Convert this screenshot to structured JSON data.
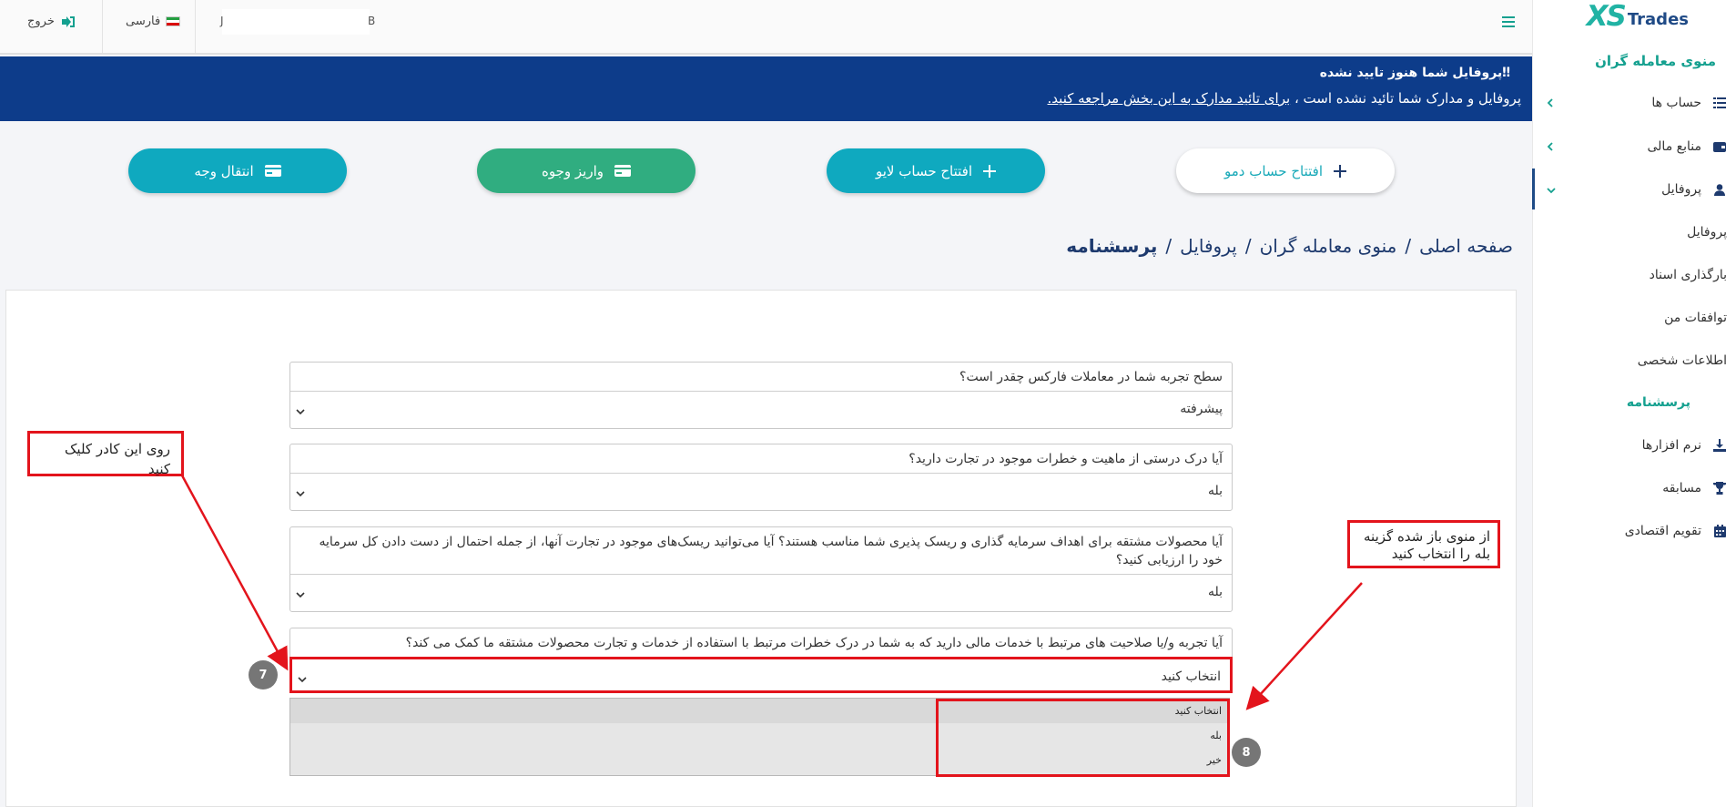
{
  "brand": {
    "logo_xs": "XS",
    "logo_trades": "Trades"
  },
  "header": {
    "language_label": "فارسی",
    "logout_label": "خروج",
    "user_fragment_left": "J",
    "user_fragment_right": "B"
  },
  "sidebar": {
    "title": "منوی معامله گران",
    "items": [
      {
        "label": "حساب ها",
        "icon": "list-icon"
      },
      {
        "label": "منابع مالی",
        "icon": "wallet-icon"
      },
      {
        "label": "پروفایل",
        "icon": "user-icon"
      }
    ],
    "profile_sub": [
      "پروفایل",
      "بارگذاری اسناد",
      "توافقات من",
      "اطلاعات شخصی",
      "پرسشنامه"
    ],
    "bottom_items": [
      {
        "label": "نرم افزارها",
        "icon": "download-icon"
      },
      {
        "label": "مسابقه",
        "icon": "trophy-icon"
      },
      {
        "label": "تقویم اقتصادی",
        "icon": "calendar-icon"
      }
    ]
  },
  "alert": {
    "title": "پروفایل شما هنوز تایید نشده",
    "text_prefix": "پروفایل و مدارک شما تائید نشده است ،",
    "link_text": "برای تائید مدارک به این بخش مراجعه کنید."
  },
  "actions": {
    "demo": "افتتاح حساب دمو",
    "live": "افتتاح حساب لایو",
    "deposit": "واریز وجوه",
    "transfer": "انتقال وجه"
  },
  "breadcrumb": [
    "صفحه اصلی",
    "منوی معامله گران",
    "پروفایل",
    "پرسشنامه"
  ],
  "questionnaire": [
    {
      "question": "سطح تجربه شما در معاملات فارکس چقدر است؟",
      "value": "پیشرفته"
    },
    {
      "question": "آیا درک درستی از ماهیت و خطرات موجود در تجارت دارید؟",
      "value": "بله"
    },
    {
      "question": "آیا محصولات مشتقه برای اهداف سرمایه گذاری و ریسک پذیری شما مناسب هستند؟ آیا می‌توانید ریسک‌های موجود در تجارت آنها، از جمله احتمال از دست دادن کل سرمایه خود را ارزیابی کنید؟",
      "value": "بله"
    },
    {
      "question": "آیا تجربه و/یا صلاحیت های مرتبط با خدمات مالی دارید که به شما در درک خطرات مرتبط با استفاده از خدمات و تجارت محصولات مشتقه ما کمک می کند؟",
      "value": "انتخاب کنید"
    }
  ],
  "dropdown_options": [
    "انتخاب کنید",
    "بله",
    "خیر"
  ],
  "annotations": {
    "click_box_note": "روی این کادر کلیک کنید",
    "choose_yes_note": "از منوی باز شده گزینه بله را انتخاب کنید",
    "step7": "7",
    "step8": "8"
  },
  "colors": {
    "accent": "#14a08f",
    "navy": "#0d3c8a",
    "highlight": "#e3141c",
    "deposit": "#30ad80",
    "cyan": "#0fa9bf"
  }
}
